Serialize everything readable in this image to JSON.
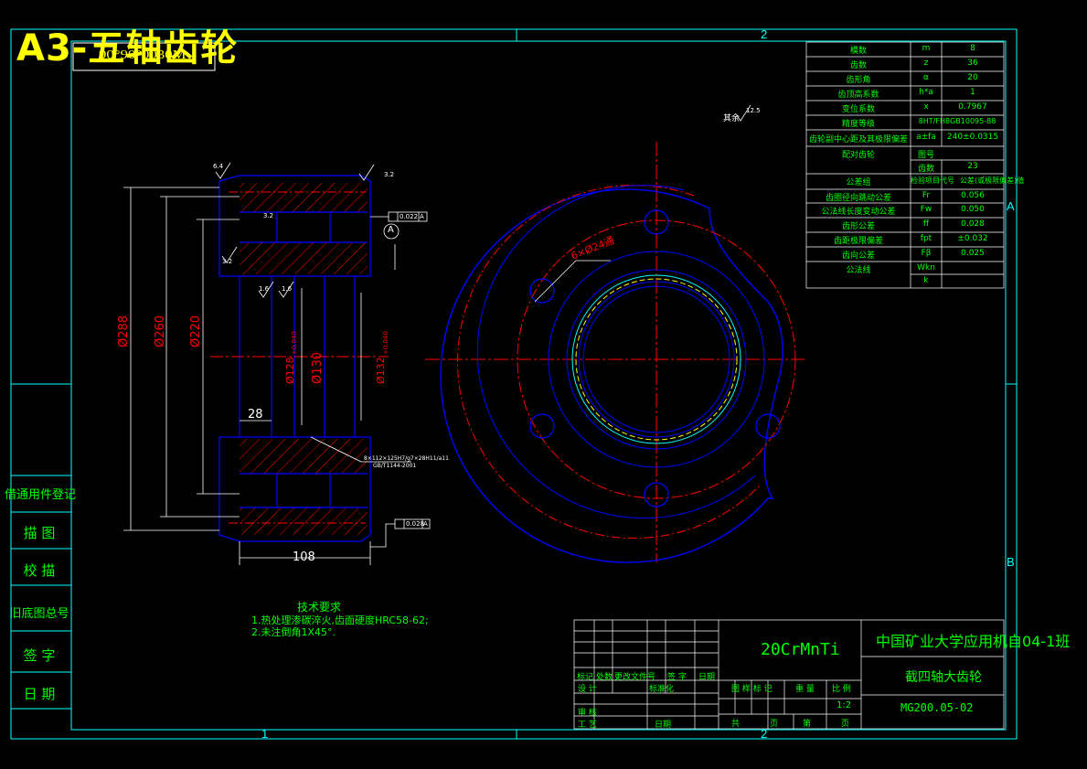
{
  "drawing_title": "A3-五轴齿轮",
  "stamp_text": "90°90°0030M",
  "zone_labels": {
    "top": "2",
    "bottom_left": "1",
    "bottom_right": "2",
    "right_a": "A",
    "right_b": "B"
  },
  "gear_params": [
    {
      "name": "模数",
      "symbol": "m",
      "value": "8"
    },
    {
      "name": "齿数",
      "symbol": "z",
      "value": "36"
    },
    {
      "name": "齿形角",
      "symbol": "α",
      "value": "20"
    },
    {
      "name": "齿顶高系数",
      "symbol": "h*a",
      "value": "1"
    },
    {
      "name": "变位系数",
      "symbol": "x",
      "value": "0.7967"
    },
    {
      "name": "精度等级",
      "symbol": "",
      "value": "8HT/FH8GB10095-88"
    },
    {
      "name": "齿轮副中心距及其极限偏差",
      "symbol": "a±fa",
      "value": "240±0.0315"
    },
    {
      "name": "配对齿轮",
      "symbol": "图号",
      "value": ""
    },
    {
      "name": "",
      "symbol": "齿数",
      "value": "23"
    },
    {
      "name": "公差组",
      "symbol": "检验项目代号",
      "value": "公差(或极限偏差)值"
    },
    {
      "name": "齿圈径向跳动公差",
      "symbol": "Fr",
      "value": "0.056"
    },
    {
      "name": "公法线长度变动公差",
      "symbol": "Fw",
      "value": "0.050"
    },
    {
      "name": "齿形公差",
      "symbol": "ff",
      "value": "0.028"
    },
    {
      "name": "齿距极限偏差",
      "symbol": "fpt",
      "value": "±0.032"
    },
    {
      "name": "齿向公差",
      "symbol": "Fβ",
      "value": "0.025"
    },
    {
      "name": "公法线",
      "symbol": "Wkn",
      "value": ""
    },
    {
      "name": "",
      "symbol": "k",
      "value": ""
    }
  ],
  "roughness_rest": "其余",
  "roughness_rest_value": "12.5",
  "dimensions": {
    "d288": "Ø288",
    "d260": "Ø260",
    "d220": "Ø220",
    "d130": "Ø130",
    "d128": "Ø128",
    "d128_tol": "+0.040",
    "d132": "Ø132",
    "d132_tol": "+0.040",
    "w28": "28",
    "w108": "108",
    "holes": "6×Ø24通",
    "rough_top": "6.4",
    "rough_right": "3.2",
    "rough_left": "3.2",
    "rough_bore": "3.2",
    "rough_a": "1.6",
    "rough_b": "1.6",
    "tol1": "0.022",
    "tol2": "0.028",
    "datum": "A",
    "spline_note": "8×112×125H7/g7×28H11/a11",
    "spline_note2": "GB/T1144-2001"
  },
  "tech_req": {
    "title": "技术要求",
    "line1": "1.热处理渗碳淬火,齿面硬度HRC58-62;",
    "line2": "2.未注倒角1X45°."
  },
  "side_labels": [
    "借通用件登记",
    "描  图",
    "校  描",
    "旧底图总号",
    "签  字",
    "日  期"
  ],
  "title_block": {
    "material": "20CrMnTi",
    "school": "中国矿业大学应用机自04-1班",
    "part_name": "截四轴大齿轮",
    "drawing_no": "MG200.05-02",
    "scale": "1:2",
    "headers": {
      "mark": "标记",
      "count": "处数",
      "doc": "更改文件号",
      "sign": "签 字",
      "date": "日期",
      "design": "设 计",
      "std": "标准化",
      "review": "审 核",
      "craft": "工 艺",
      "approve_date": "日期",
      "tag": "图 样 标 记",
      "weight": "重 量",
      "ratio": "比 例",
      "total": "共",
      "page": "页",
      "sheet": "第",
      "page2": "页"
    }
  },
  "colors": {
    "frame": "#00ffff",
    "cad_white": "#ffffff",
    "cad_blue": "#0000ff",
    "cad_red": "#ff0000",
    "cad_green": "#00ff00",
    "cad_yellow": "#ffff00"
  }
}
